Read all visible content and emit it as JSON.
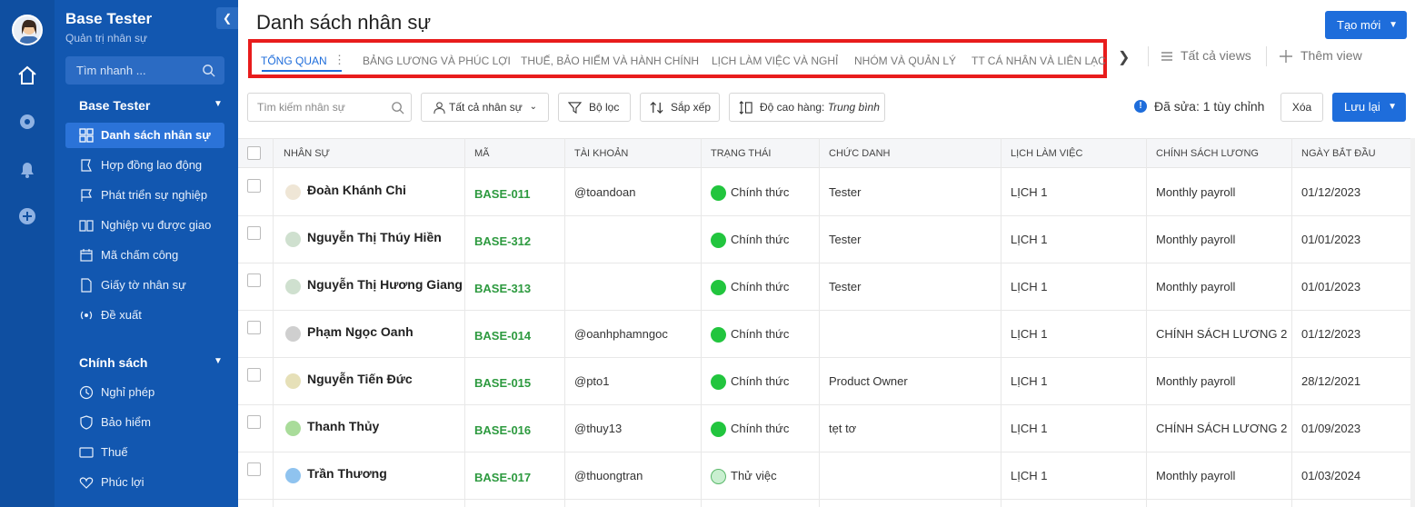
{
  "sidebar": {
    "title": "Base Tester",
    "subtitle": "Quản trị nhân sự",
    "search_placeholder": "Tìm nhanh ...",
    "group1": "Base Tester",
    "items": [
      {
        "label": "Danh sách nhân sự",
        "icon": "grid-icon",
        "active": true
      },
      {
        "label": "Hợp đồng lao động",
        "icon": "contract-icon"
      },
      {
        "label": "Phát triển sự nghiệp",
        "icon": "flag-icon"
      },
      {
        "label": "Nghiệp vụ được giao",
        "icon": "book-icon"
      },
      {
        "label": "Mã chấm công",
        "icon": "calendar-icon"
      },
      {
        "label": "Giấy tờ nhân sự",
        "icon": "document-icon"
      },
      {
        "label": "Đề xuất",
        "icon": "broadcast-icon"
      }
    ],
    "group2": "Chính sách",
    "items2": [
      {
        "label": "Nghỉ phép",
        "icon": "clock-icon"
      },
      {
        "label": "Bảo hiểm",
        "icon": "shield-icon"
      },
      {
        "label": "Thuế",
        "icon": "tax-icon"
      },
      {
        "label": "Phúc lợi",
        "icon": "heart-icon"
      }
    ]
  },
  "header": {
    "title": "Danh sách nhân sự",
    "create_label": "Tạo mới"
  },
  "tabs": [
    {
      "label": "TỔNG QUAN",
      "active": true
    },
    {
      "label": "BẢNG LƯƠNG VÀ PHÚC LỢI"
    },
    {
      "label": "THUẾ, BẢO HIỂM VÀ HÀNH CHÍNH"
    },
    {
      "label": "LỊCH LÀM VIỆC VÀ NGHỈ"
    },
    {
      "label": "NHÓM VÀ QUẢN LÝ"
    },
    {
      "label": "TT CÁ NHÂN VÀ LIÊN LẠC"
    }
  ],
  "views": {
    "all_views": "Tất cả views",
    "add_view": "Thêm view"
  },
  "toolbar": {
    "search_placeholder": "Tìm kiếm nhân sự",
    "filter_all": "Tất cả nhân sự",
    "filter": "Bộ lọc",
    "sort": "Sắp xếp",
    "row_height_label": "Độ cao hàng:",
    "row_height_value": "Trung bình",
    "edited": "Đã sửa: 1 tùy chỉnh",
    "clear": "Xóa",
    "save": "Lưu lại"
  },
  "table": {
    "headers": [
      "NHÂN SỰ",
      "MÃ",
      "TÀI KHOẢN",
      "TRẠNG THÁI",
      "CHỨC DANH",
      "LỊCH LÀM VIỆC",
      "CHÍNH SÁCH LƯƠNG",
      "NGÀY BẮT ĐẦU"
    ],
    "rows": [
      {
        "name": "Đoàn Khánh Chi",
        "code": "BASE-011",
        "account": "@toandoan",
        "status": "Chính thức",
        "title": "Tester",
        "schedule": "LỊCH 1",
        "policy": "Monthly payroll",
        "start": "01/12/2023",
        "avatar": "#efe6d6",
        "status_color": "#22c53e"
      },
      {
        "name": "Nguyễn Thị Thúy Hiền",
        "code": "BASE-312",
        "account": "",
        "status": "Chính thức",
        "title": "Tester",
        "schedule": "LỊCH 1",
        "policy": "Monthly payroll",
        "start": "01/01/2023",
        "avatar": "#cfe0cf",
        "status_color": "#22c53e"
      },
      {
        "name": "Nguyễn Thị Hương Giang",
        "code": "BASE-313",
        "account": "",
        "status": "Chính thức",
        "title": "Tester",
        "schedule": "LỊCH 1",
        "policy": "Monthly payroll",
        "start": "01/01/2023",
        "avatar": "#cfe0cf",
        "status_color": "#22c53e"
      },
      {
        "name": "Phạm Ngọc Oanh",
        "code": "BASE-014",
        "account": "@oanhphamngoc",
        "status": "Chính thức",
        "title": "",
        "schedule": "LỊCH 1",
        "policy": "CHÍNH SÁCH LƯƠNG 2",
        "start": "01/12/2023",
        "avatar": "#cfcfcf",
        "status_color": "#22c53e"
      },
      {
        "name": "Nguyễn Tiến Đức",
        "code": "BASE-015",
        "account": "@pto1",
        "status": "Chính thức",
        "title": "Product Owner",
        "schedule": "LỊCH 1",
        "policy": "Monthly payroll",
        "start": "28/12/2021",
        "avatar": "#e6e0b8",
        "status_color": "#22c53e"
      },
      {
        "name": "Thanh Thủy",
        "code": "BASE-016",
        "account": "@thuy13",
        "status": "Chính thức",
        "title": "tẹt tơ",
        "schedule": "LỊCH 1",
        "policy": "CHÍNH SÁCH LƯƠNG 2",
        "start": "01/09/2023",
        "avatar": "#a9dc9a",
        "status_color": "#22c53e"
      },
      {
        "name": "Trần Thương",
        "code": "BASE-017",
        "account": "@thuongtran",
        "status": "Thử việc",
        "title": "",
        "schedule": "LỊCH 1",
        "policy": "Monthly payroll",
        "start": "01/03/2024",
        "avatar": "#8fc3ef",
        "status_color": "#c9efd0"
      }
    ]
  }
}
